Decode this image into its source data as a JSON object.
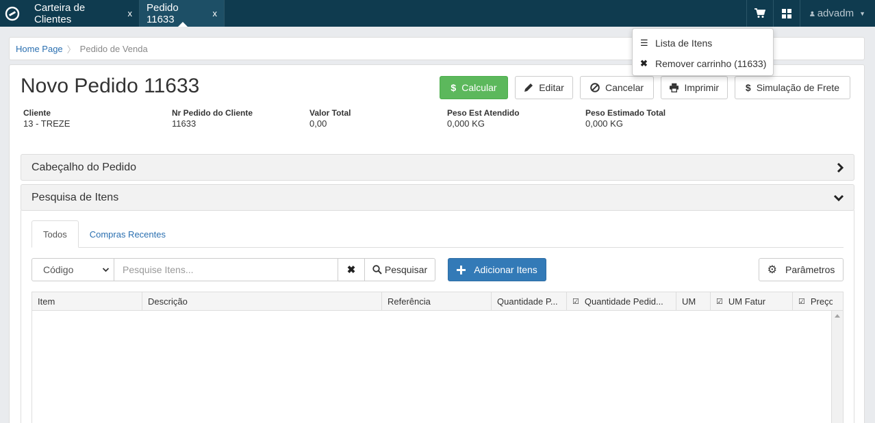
{
  "topbar": {
    "tabs": [
      {
        "label": "Carteira de Clientes",
        "close": "x"
      },
      {
        "label": "Pedido 11633",
        "close": "x"
      }
    ],
    "user": "advadm"
  },
  "dropdown": {
    "items": [
      {
        "label": "Lista de Itens",
        "icon": "list-icon"
      },
      {
        "label": "Remover carrinho (11633)",
        "icon": "remove-icon"
      }
    ]
  },
  "breadcrumb": {
    "home": "Home Page",
    "current": "Pedido de Venda"
  },
  "page": {
    "title": "Novo Pedido 11633",
    "actions": {
      "calcular": "Calcular",
      "editar": "Editar",
      "cancelar": "Cancelar",
      "imprimir": "Imprimir",
      "frete": "Simulação de Frete"
    },
    "info": [
      {
        "label": "Cliente",
        "value": "13 - TREZE"
      },
      {
        "label": "Nr Pedido do Cliente",
        "value": "11633"
      },
      {
        "label": "Valor Total",
        "value": "0,00"
      },
      {
        "label": "Peso Est Atendido",
        "value": "0,000 KG"
      },
      {
        "label": "Peso Estimado Total",
        "value": "0,000 KG"
      }
    ]
  },
  "panels": {
    "header": "Cabeçalho do Pedido",
    "search": "Pesquisa de Itens"
  },
  "search": {
    "tabs": [
      "Todos",
      "Compras Recentes"
    ],
    "field_select": "Código",
    "placeholder": "Pesquise Itens...",
    "search_label": "Pesquisar",
    "add_label": "Adicionar Itens",
    "params_label": "Parâmetros"
  },
  "grid": {
    "columns": [
      "Item",
      "Descrição",
      "Referência",
      "Quantidade P...",
      "Quantidade Pedid...",
      "UM",
      "UM Fatur",
      "Preço"
    ]
  },
  "colors": {
    "topbar": "#0f3b4f",
    "accent_green": "#5cb85c",
    "accent_blue": "#337ab7",
    "link": "#2a6fb0"
  }
}
